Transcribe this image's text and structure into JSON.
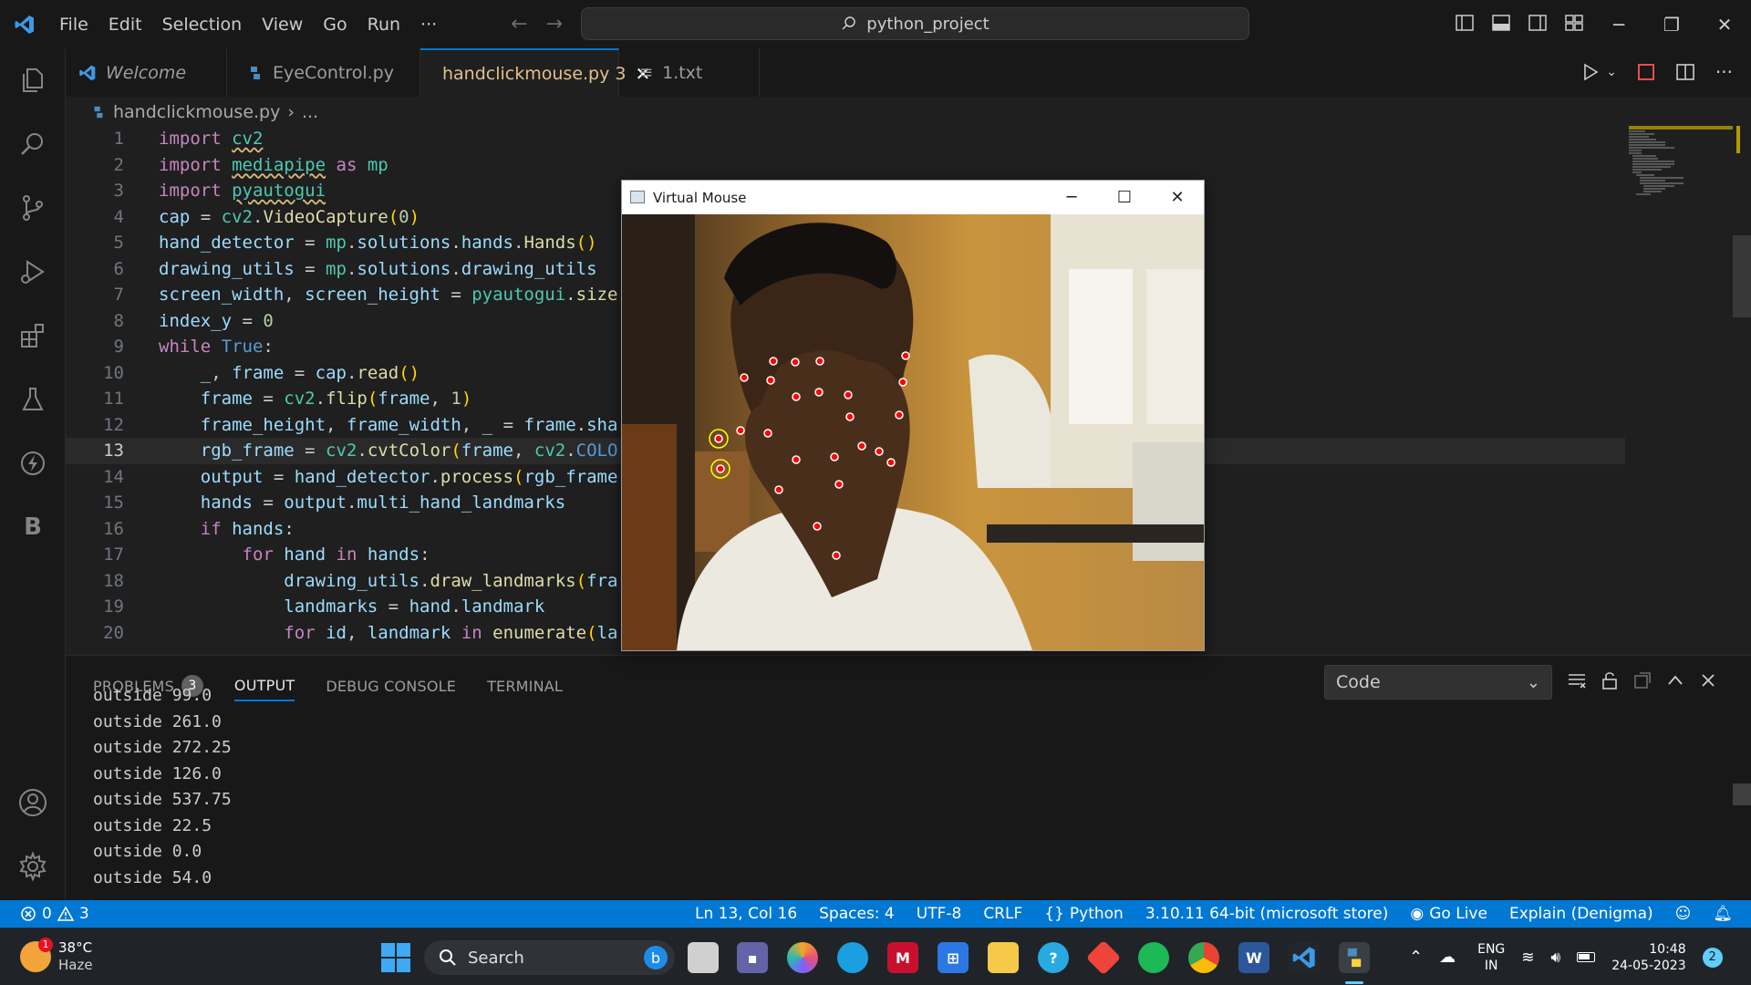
{
  "app": {
    "menu": [
      "File",
      "Edit",
      "Selection",
      "View",
      "Go",
      "Run",
      "···"
    ],
    "search_text": "python_project"
  },
  "tabs": [
    {
      "label": "Welcome"
    },
    {
      "label": "EyeControl.py"
    },
    {
      "label": "handclickmouse.py",
      "badge": "3"
    },
    {
      "label": "1.txt"
    }
  ],
  "breadcrumb": {
    "file": "handclickmouse.py",
    "rest": "..."
  },
  "editor": {
    "line_numbers": [
      "1",
      "2",
      "3",
      "4",
      "5",
      "6",
      "7",
      "8",
      "9",
      "10",
      "11",
      "12",
      "13",
      "14",
      "15",
      "16",
      "17",
      "18",
      "19",
      "20"
    ],
    "current_line": "13"
  },
  "panel": {
    "tabs": [
      "PROBLEMS",
      "OUTPUT",
      "DEBUG CONSOLE",
      "TERMINAL"
    ],
    "problems_count": "3",
    "output_channel": "Code",
    "output_lines": [
      "outside 99.0",
      "outside 261.0",
      "outside 272.25",
      "outside 126.0",
      "outside 537.75",
      "outside 22.5",
      "outside 0.0",
      "outside 54.0"
    ]
  },
  "statusbar": {
    "errors": "0",
    "warnings": "3",
    "position": "Ln 13, Col 16",
    "spaces": "Spaces: 4",
    "encoding": "UTF-8",
    "eol": "CRLF",
    "language": "Python",
    "interpreter": "3.10.11 64-bit (microsoft store)",
    "golive": "Go Live",
    "explain": "Explain (Denigma)"
  },
  "virtual_mouse": {
    "title": "Virtual Mouse"
  },
  "taskbar": {
    "weather_temp": "38°C",
    "weather_desc": "Haze",
    "weather_badge": "1",
    "search_label": "Search",
    "lang_top": "ENG",
    "lang_bottom": "IN",
    "time": "10:48",
    "date": "24-05-2023",
    "notif_count": "2"
  },
  "colors": {
    "accent": "#0078d4",
    "keyword": "#c586c0",
    "function": "#dcdcaa",
    "number": "#b5cea8",
    "modified_tab": "#e2c08d"
  }
}
